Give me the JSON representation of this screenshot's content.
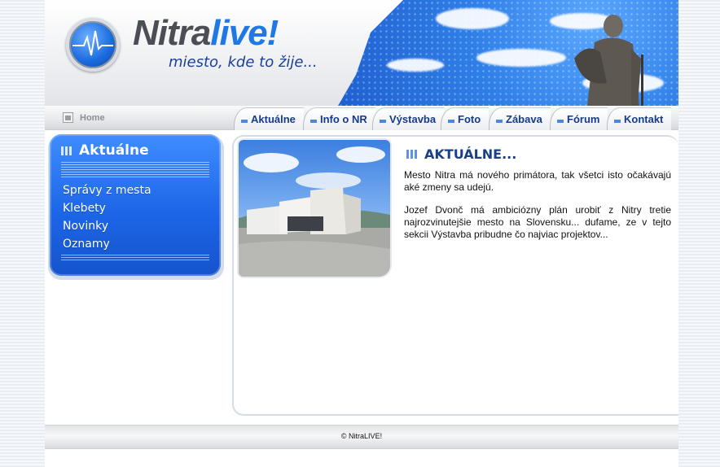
{
  "brand": {
    "name_part1": "Nitra",
    "name_part2": "live!",
    "tagline": "miesto, kde to žije..."
  },
  "nav": {
    "home_label": "Home",
    "tabs": [
      {
        "label": "Aktuálne"
      },
      {
        "label": "Info o NR"
      },
      {
        "label": "Výstavba"
      },
      {
        "label": "Foto"
      },
      {
        "label": "Zábava"
      },
      {
        "label": "Fórum"
      },
      {
        "label": "Kontakt"
      }
    ]
  },
  "sidebar": {
    "title": "Aktuálne",
    "items": [
      {
        "label": "Správy z mesta"
      },
      {
        "label": "Klebety"
      },
      {
        "label": "Novinky"
      },
      {
        "label": "Oznamy"
      }
    ]
  },
  "content": {
    "title": "AKTUÁLNE...",
    "paragraphs": [
      "Mesto Nitra má nového primátora, tak všetci isto očakávajú aké zmeny sa udejú.",
      "Jozef Dvonč má ambiciózny plán urobiť z Nitry tretie najrozvinutejšie mesto na Slovensku... dufame, ze v tejto sekcii Výstavba pribudne čo najviac projektov..."
    ]
  },
  "footer": {
    "copyright": "© NitraLIVE!"
  },
  "colors": {
    "accent_blue": "#1f78e6",
    "nav_text": "#163a8c",
    "sidebar_blue": "#1d66e8"
  }
}
